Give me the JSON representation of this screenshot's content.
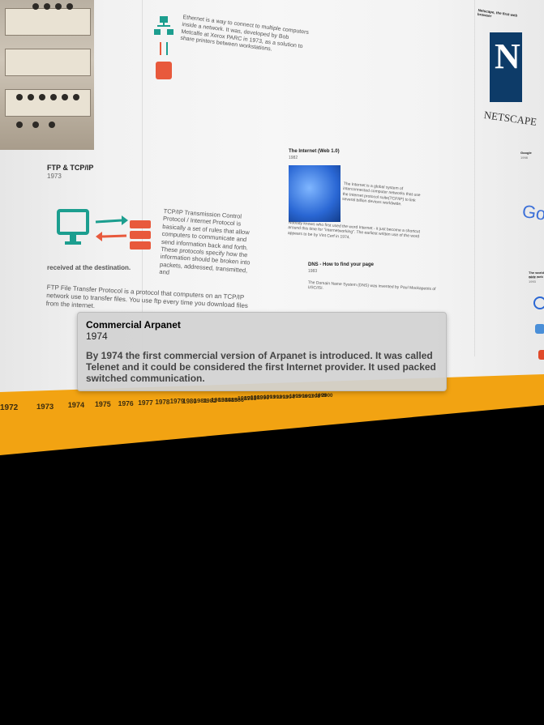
{
  "ethernet": {
    "text": "Ethernet is a way to connect to multiple computers inside a network. It was, developed by Bob Metcalfe at Xerox PARC in 1973, as a solution to share printers between workstations."
  },
  "ftp_tcp": {
    "title": "FTP & TCP/IP",
    "year": "1973",
    "tcp_text": "TCP/IP Transmission Control Protocol / Internet Protocol is basically a set of rules that allow computers to communicate and send information back and forth. These protocols specify how the information should be broken into packets, addressed, transmitted, and",
    "received_text": "received at the destination.",
    "ftp_text": "FTP File Transfer Protocol is a protocol that computers on an TCP/IP network use to transfer files. You use ftp every time you download files from the internet."
  },
  "web": {
    "title": "The Internet (Web 1.0)",
    "year": "1982",
    "text1": "The Internet is a global system of interconnected computer networks that use the Internet protocol suite(TCP/IP) to link several billion devices worldwide.",
    "text2": "Nobody knows who first used the word Internet - it just become a shortcut around this time for \"internetworking\". The earliest written use of the word appears to be by Vint Cerf in 1974."
  },
  "dns": {
    "title": "DNS - How to find your page",
    "year": "1983",
    "text": "The Domain Name System (DNS) was invented by Paul Mockapetris of USC/ISI."
  },
  "netscape": {
    "title": "Netscape, the first web browser",
    "letter": "N",
    "word": "NETSCAPE"
  },
  "google": {
    "label": "Google",
    "year": "1998",
    "logo": "Goog"
  },
  "www": {
    "title": "The world wide web",
    "year": "1991 - 1993"
  },
  "popup": {
    "title": "Commercial Arpanet",
    "year": "1974",
    "text": "By 1974 the first commercial version of Arpanet is introduced. It was called Telenet and it could be considered the first Internet provider. It used packed switched communication."
  },
  "timeline": {
    "years": [
      "1972",
      "1973",
      "1974",
      "1975",
      "1976",
      "1977",
      "1978",
      "1979",
      "1980",
      "1981",
      "1982",
      "1983",
      "1984",
      "1985",
      "1986",
      "1987",
      "1988",
      "1989",
      "1990",
      "1991",
      "1992",
      "1993",
      "1994",
      "1995",
      "1996",
      "1997",
      "1998",
      "1999",
      "2000"
    ]
  },
  "colors": {
    "timeline": "#f2a312",
    "icon_green": "#1c9e8f",
    "icon_orange": "#e8593c",
    "netscape_blue": "#0d3b68"
  }
}
